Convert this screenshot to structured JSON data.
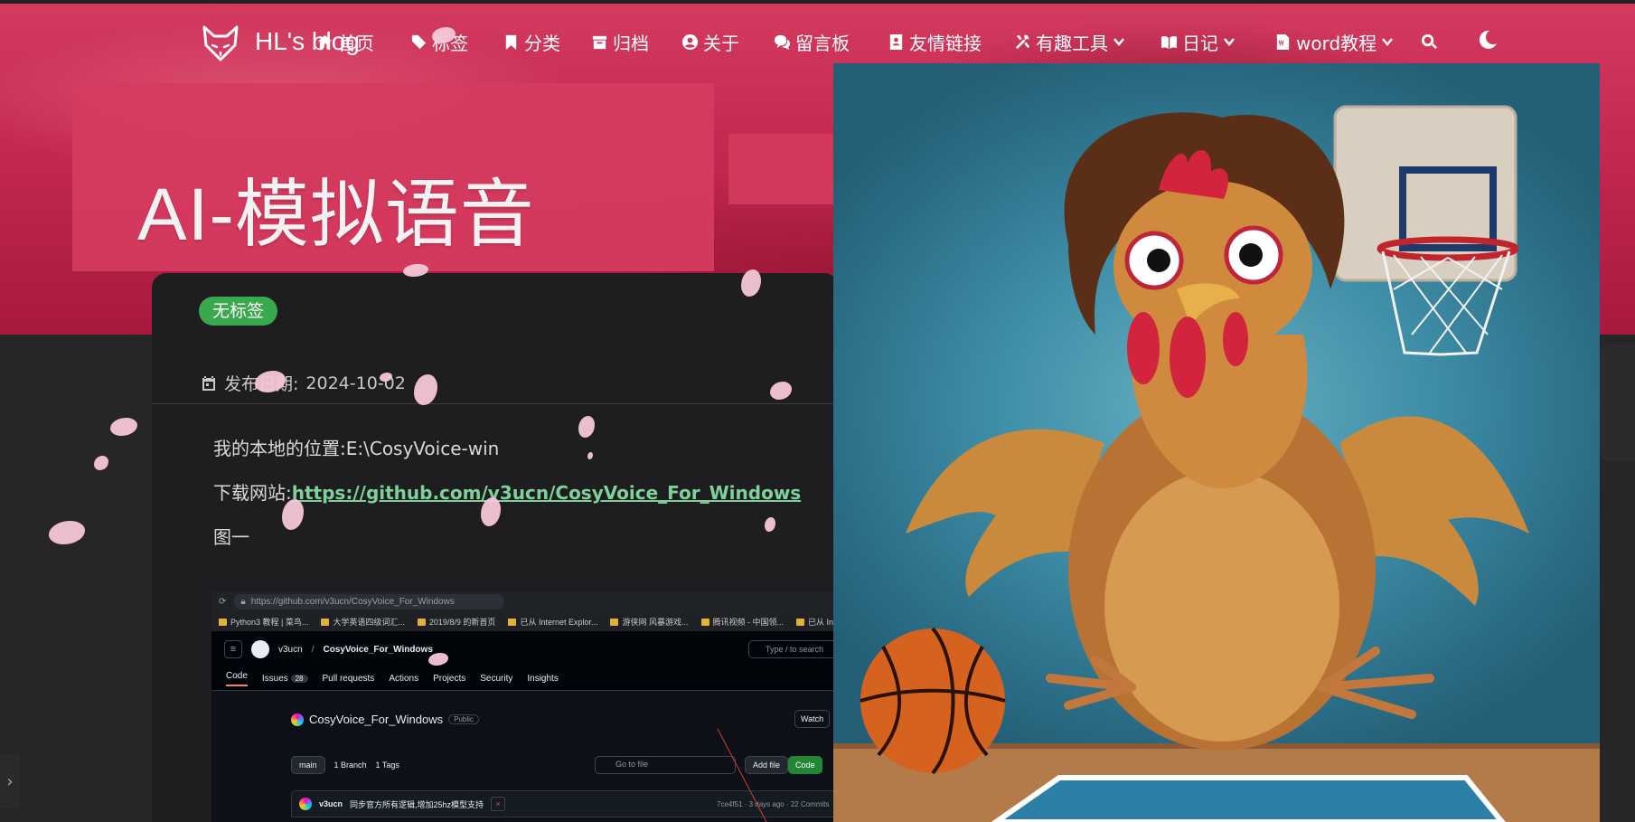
{
  "nav": {
    "brand": "HL's blog",
    "items": [
      {
        "label": "首页",
        "icon": "home-icon"
      },
      {
        "label": "标签",
        "icon": "tag-icon"
      },
      {
        "label": "分类",
        "icon": "bookmark-icon"
      },
      {
        "label": "归档",
        "icon": "archive-icon"
      },
      {
        "label": "关于",
        "icon": "user-circle-icon"
      },
      {
        "label": "留言板",
        "icon": "comments-icon"
      },
      {
        "label": "友情链接",
        "icon": "address-book-icon"
      },
      {
        "label": "有趣工具",
        "icon": "tools-icon"
      },
      {
        "label": "日记",
        "icon": "book-icon"
      },
      {
        "label": "word教程",
        "icon": "word-icon"
      }
    ],
    "search_icon": "search-icon",
    "theme_icon": "moon-icon"
  },
  "post": {
    "title": "AI-模拟语音",
    "tag": "无标签",
    "date_label": "发布日期:",
    "date": "2024-10-02",
    "location_line": "我的本地的位置:E:\\CosyVoice-win",
    "download_label": "下载网站:",
    "download_url": "https://github.com/v3ucn/CosyVoice_For_Windows",
    "figure_label": "图一"
  },
  "screenshot": {
    "url": "https://github.com/v3ucn/CosyVoice_For_Windows",
    "bookmarks": [
      "Python3 教程 | 菜鸟...",
      "大学英语四级词汇...",
      "2019/8/9 的新首页",
      "已从 Internet Explor...",
      "游侠网 风暴游戏...",
      "腾讯视频 - 中国领...",
      "已从 Inter"
    ],
    "owner": "v3ucn",
    "repo": "CosyVoice_For_Windows",
    "search_placeholder": "Type / to search",
    "tabs": [
      "Code",
      "Issues",
      "Pull requests",
      "Actions",
      "Projects",
      "Security",
      "Insights"
    ],
    "issues_count": "28",
    "visibility": "Public",
    "watch": "Watch",
    "branch": "main",
    "branches": "1 Branch",
    "tags": "1 Tags",
    "goto_placeholder": "Go to file",
    "add_file": "Add file",
    "code_button": "Code",
    "commit_author": "v3ucn",
    "commit_message": "同步官方所有逻辑,增加25hz模型支持",
    "commit_meta": "7ce4f51 · 3 days ago",
    "commits": "22 Commits"
  },
  "colors": {
    "banner": "#c4284f",
    "tag_green": "#3aa84f",
    "link": "#7fd199"
  }
}
